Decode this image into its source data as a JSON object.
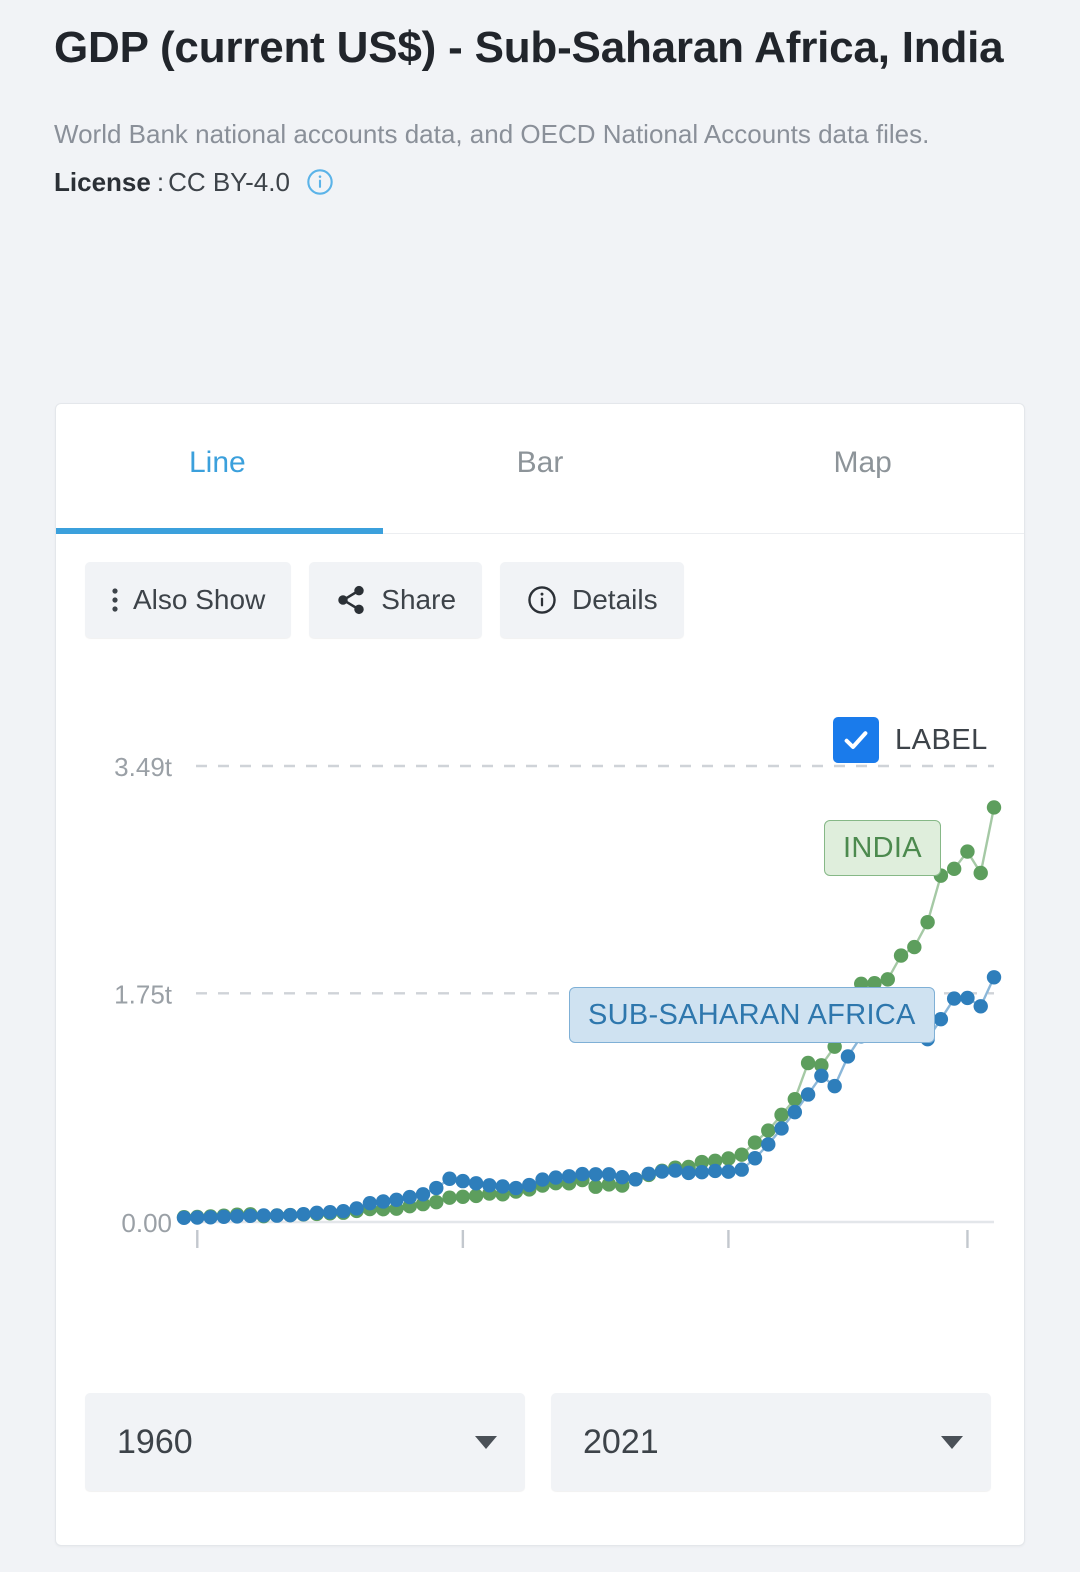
{
  "header": {
    "title": "GDP (current US$) - Sub-Saharan Africa, India",
    "source": "World Bank national accounts data, and OECD National Accounts data files.",
    "license_label": "License",
    "license_separator": ":",
    "license_value": "CC BY-4.0",
    "info_icon": "info-icon"
  },
  "tabs": [
    {
      "label": "Line",
      "active": true
    },
    {
      "label": "Bar",
      "active": false
    },
    {
      "label": "Map",
      "active": false
    }
  ],
  "toolbar": [
    {
      "label": "Also Show",
      "icon": "kebab-menu-icon"
    },
    {
      "label": "Share",
      "icon": "share-icon"
    },
    {
      "label": "Details",
      "icon": "info-circle-icon"
    }
  ],
  "chart_controls": {
    "label_checkbox": {
      "label": "LABEL",
      "checked": true
    }
  },
  "footer": {
    "start_year": "1960",
    "end_year": "2021",
    "caret_icon": "chevron-down-icon"
  },
  "colors": {
    "accent_blue": "#3ba0dc",
    "checkbox_blue": "#1a7beb",
    "india_green": "#5d9e5d",
    "ssa_blue": "#2e7ebb",
    "page_bg": "#f1f3f6",
    "card_bg": "#ffffff",
    "muted_text": "#8a9099"
  },
  "chart_data": {
    "type": "line",
    "title": "GDP (current US$) - Sub-Saharan Africa, India",
    "xlabel": "",
    "ylabel": "",
    "grid": true,
    "gridlines_dashed": true,
    "legend": "inline-labels",
    "ylim": [
      0,
      3.49
    ],
    "y_unit": "trillions US$",
    "ytick_labels": [
      "0.00",
      "1.75t",
      "3.49t"
    ],
    "ytick_values": [
      0,
      1.75,
      3.49
    ],
    "xlim": [
      1960,
      2021
    ],
    "xtick_labels": [
      "",
      "",
      "",
      ""
    ],
    "xtick_values": [
      1961,
      1981,
      2001,
      2019
    ],
    "x": [
      1960,
      1961,
      1962,
      1963,
      1964,
      1965,
      1966,
      1967,
      1968,
      1969,
      1970,
      1971,
      1972,
      1973,
      1974,
      1975,
      1976,
      1977,
      1978,
      1979,
      1980,
      1981,
      1982,
      1983,
      1984,
      1985,
      1986,
      1987,
      1988,
      1989,
      1990,
      1991,
      1992,
      1993,
      1994,
      1995,
      1996,
      1997,
      1998,
      1999,
      2000,
      2001,
      2002,
      2003,
      2004,
      2005,
      2006,
      2007,
      2008,
      2009,
      2010,
      2011,
      2012,
      2013,
      2014,
      2015,
      2016,
      2017,
      2018,
      2019,
      2020,
      2021
    ],
    "series": [
      {
        "name": "INDIA",
        "color": "#5d9e5d",
        "values": [
          0.037,
          0.039,
          0.042,
          0.048,
          0.056,
          0.059,
          0.045,
          0.05,
          0.053,
          0.058,
          0.062,
          0.067,
          0.071,
          0.085,
          0.099,
          0.098,
          0.102,
          0.121,
          0.137,
          0.152,
          0.186,
          0.193,
          0.2,
          0.218,
          0.212,
          0.233,
          0.249,
          0.279,
          0.297,
          0.296,
          0.321,
          0.27,
          0.288,
          0.279,
          0.327,
          0.36,
          0.392,
          0.416,
          0.421,
          0.459,
          0.468,
          0.486,
          0.515,
          0.608,
          0.7,
          0.82,
          0.94,
          1.217,
          1.199,
          1.342,
          1.676,
          1.823,
          1.828,
          1.857,
          2.039,
          2.104,
          2.295,
          2.651,
          2.703,
          2.835,
          2.671,
          3.173
        ]
      },
      {
        "name": "SUB-SAHARAN AFRICA",
        "color": "#2e7ebb",
        "values": [
          0.032,
          0.034,
          0.036,
          0.04,
          0.043,
          0.047,
          0.05,
          0.049,
          0.052,
          0.06,
          0.07,
          0.075,
          0.083,
          0.104,
          0.144,
          0.157,
          0.17,
          0.191,
          0.212,
          0.26,
          0.331,
          0.313,
          0.296,
          0.281,
          0.272,
          0.26,
          0.283,
          0.325,
          0.34,
          0.35,
          0.367,
          0.365,
          0.365,
          0.343,
          0.327,
          0.369,
          0.386,
          0.394,
          0.376,
          0.381,
          0.391,
          0.385,
          0.401,
          0.488,
          0.594,
          0.716,
          0.841,
          0.976,
          1.119,
          1.04,
          1.267,
          1.421,
          1.485,
          1.564,
          1.645,
          1.479,
          1.399,
          1.552,
          1.71,
          1.715,
          1.651,
          1.873
        ]
      }
    ],
    "annotations": [
      {
        "text": "INDIA",
        "series": "INDIA",
        "style": "green-chip"
      },
      {
        "text": "SUB-SAHARAN AFRICA",
        "series": "SUB-SAHARAN AFRICA",
        "style": "blue-chip"
      }
    ]
  }
}
